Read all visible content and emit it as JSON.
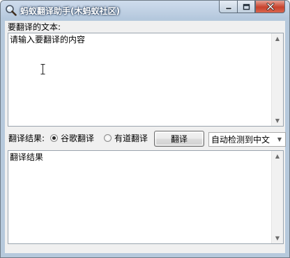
{
  "window": {
    "title": "蚂蚁翻译助手(木蚂蚁社区)"
  },
  "icons": {
    "app": "magnifier-icon",
    "minimize": "minimize-icon",
    "maximize": "maximize-icon",
    "close": "close-icon"
  },
  "source": {
    "label": "要翻译的文本:",
    "value": "请输入要翻译的内容"
  },
  "options": {
    "result_label": "翻译结果:",
    "engines": [
      {
        "label": "谷歌翻译",
        "checked": true
      },
      {
        "label": "有道翻译",
        "checked": false
      }
    ],
    "translate_button": "翻译",
    "language_selected": "自动检测到中文"
  },
  "result": {
    "value": "翻译结果"
  },
  "colors": {
    "close_button": "#c7422c",
    "dialog_bg": "#f0f0f0",
    "frame": "#b6c9dc"
  }
}
